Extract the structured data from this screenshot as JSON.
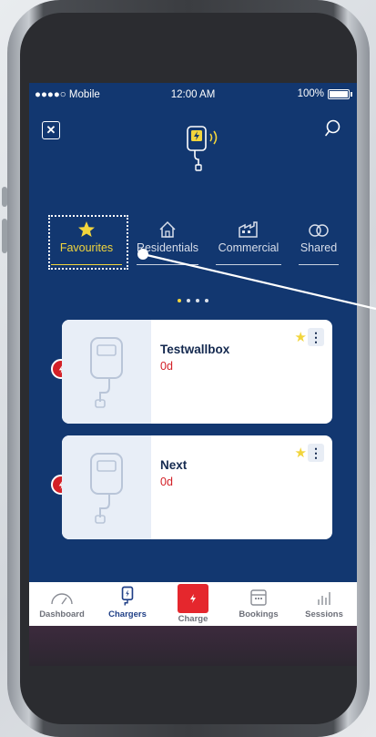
{
  "status_bar": {
    "carrier": "●●●●○ Mobile",
    "time": "12:00 AM",
    "battery": "100%"
  },
  "header": {
    "close_icon": "close-icon",
    "search_icon": "search-icon",
    "logo_icon": "wallbox-logo-icon"
  },
  "tabs": [
    {
      "label": "Favourites",
      "icon": "star-icon",
      "active": true
    },
    {
      "label": "Residentials",
      "icon": "house-icon",
      "active": false
    },
    {
      "label": "Commercial",
      "icon": "factory-icon",
      "active": false
    },
    {
      "label": "Shared",
      "icon": "link-icon",
      "active": false
    }
  ],
  "pager": {
    "count": 4,
    "active": 0
  },
  "chargers": [
    {
      "name": "Testwallbox",
      "status": "0d",
      "favourite": true
    },
    {
      "name": "Next",
      "status": "0d",
      "favourite": true
    }
  ],
  "bottom_nav": [
    {
      "label": "Dashboard",
      "icon": "gauge-icon",
      "active": false
    },
    {
      "label": "Chargers",
      "icon": "charger-icon",
      "active": true
    },
    {
      "label": "Charge",
      "icon": "bolt-icon",
      "active": false
    },
    {
      "label": "Bookings",
      "icon": "calendar-icon",
      "active": false
    },
    {
      "label": "Sessions",
      "icon": "bar-chart-icon",
      "active": false
    }
  ],
  "colors": {
    "screen_bg": "#123770",
    "accent_yellow": "#f2d53c",
    "accent_red": "#d32027",
    "nav_active": "#1f3f86"
  }
}
